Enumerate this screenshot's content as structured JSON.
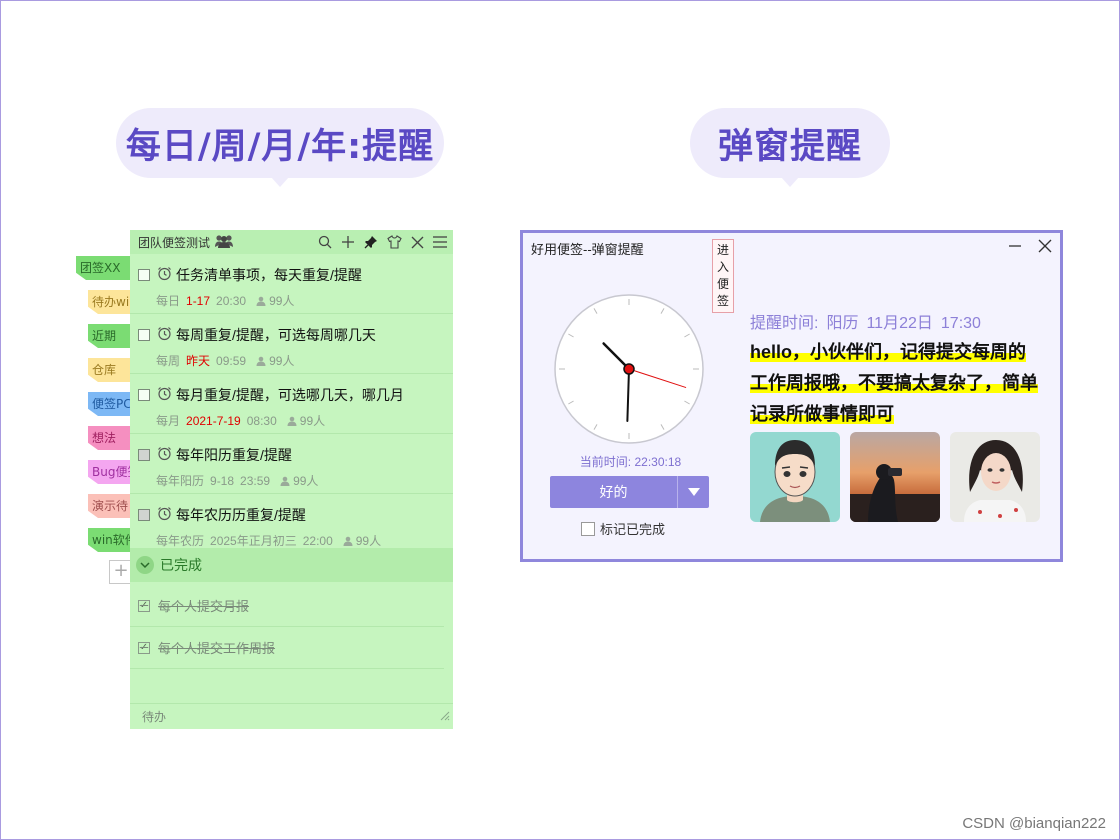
{
  "headings": {
    "left": "每日/周/月/年:提醒",
    "right": "弹窗提醒"
  },
  "side_tabs": [
    {
      "label": "团签XX",
      "color": "#7bdc73",
      "text_color": "#2a6a2a"
    },
    {
      "label": "待办win",
      "color": "#fde59a",
      "text_color": "#9a7a20"
    },
    {
      "label": "近期",
      "color": "#7bdc73",
      "text_color": "#2a6a2a"
    },
    {
      "label": "仓库",
      "color": "#fde59a",
      "text_color": "#9a7a20"
    },
    {
      "label": "便签PC",
      "color": "#7db8f5",
      "text_color": "#1f5aa0"
    },
    {
      "label": "想法",
      "color": "#f58fc0",
      "text_color": "#a02060"
    },
    {
      "label": "Bug便签",
      "color": "#f4a6f0",
      "text_color": "#a030a0"
    },
    {
      "label": "演示待",
      "color": "#fbc0b8",
      "text_color": "#a05050"
    },
    {
      "label": "win软件",
      "color": "#7bdc73",
      "text_color": "#2a6a2a"
    }
  ],
  "note": {
    "title": "团队便签测试",
    "tasks": [
      {
        "title": "任务清单事项，每天重复/提醒",
        "repeat": "每日",
        "date": "1-17",
        "time": "20:30",
        "people": "99人",
        "date_red": true
      },
      {
        "title": "每周重复/提醒，可选每周哪几天",
        "repeat": "每周",
        "date": "昨天",
        "time": "09:59",
        "people": "99人",
        "date_red": true
      },
      {
        "title": "每月重复/提醒，可选哪几天，哪几月",
        "repeat": "每月",
        "date": "2021-7-19",
        "time": "08:30",
        "people": "99人",
        "date_red": true
      },
      {
        "title": "每年阳历重复/提醒",
        "repeat": "每年阳历",
        "date": "9-18",
        "time": "23:59",
        "people": "99人",
        "date_red": false
      },
      {
        "title": "每年农历历重复/提醒",
        "repeat": "每年农历",
        "date": "2025年正月初三",
        "time": "22:00",
        "people": "99人",
        "date_red": false
      }
    ],
    "done_label": "已完成",
    "done_items": [
      "每个人提交月报",
      "每个人提交工作周报"
    ],
    "footer": "待办"
  },
  "popup": {
    "title": "好用便签--弹窗提醒",
    "enter_label": "进入便签",
    "current_time_label": "当前时间: 22:30:18",
    "clock": {
      "hours": 22,
      "minutes": 30,
      "seconds": 18
    },
    "ok_label": "好的",
    "mark_label": "标记已完成",
    "remind_label": "提醒时间:",
    "remind_calendar": "阳历",
    "remind_date": "11月22日",
    "remind_time": "17:30",
    "message_lines": [
      "hello，小伙伴们，记得提交每周的",
      "工作周报哦，不要搞太复杂了，简单",
      "记录所做事情即可"
    ],
    "images": [
      "cartoon-avatar",
      "sunset-photo",
      "portrait-photo"
    ]
  },
  "watermark": "CSDN @bianqian222",
  "colors": {
    "accent": "#5a49c4",
    "note_green": "#c6f5bf",
    "popup_border": "#8f87dc",
    "button": "#8d85de"
  }
}
